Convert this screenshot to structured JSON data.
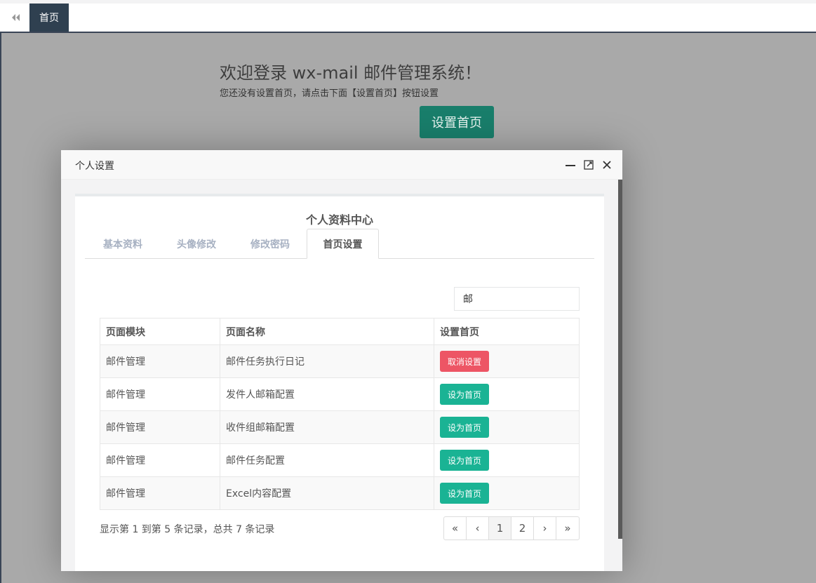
{
  "topbar": {
    "home_tab": "首页"
  },
  "welcome": {
    "title": "欢迎登录 wx-mail 邮件管理系统！",
    "subtitle": "您还没有设置首页，请点击下面【设置首页】按钮设置",
    "set_home_button": "设置首页"
  },
  "modal": {
    "title": "个人设置",
    "panel_title": "个人资料中心",
    "tabs": [
      {
        "label": "基本资料"
      },
      {
        "label": "头像修改"
      },
      {
        "label": "修改密码"
      },
      {
        "label": "首页设置"
      }
    ],
    "active_tab": "首页设置",
    "search": {
      "value": "邮",
      "placeholder": ""
    },
    "table": {
      "headers": [
        "页面模块",
        "页面名称",
        "设置首页"
      ],
      "rows": [
        {
          "module": "邮件管理",
          "name": "邮件任务执行日记",
          "action": "取消设置"
        },
        {
          "module": "邮件管理",
          "name": "发件人邮箱配置",
          "action": "设为首页"
        },
        {
          "module": "邮件管理",
          "name": "收件组邮箱配置",
          "action": "设为首页"
        },
        {
          "module": "邮件管理",
          "name": "邮件任务配置",
          "action": "设为首页"
        },
        {
          "module": "邮件管理",
          "name": "Excel内容配置",
          "action": "设为首页"
        }
      ]
    },
    "page_info": "显示第 1 到第 5 条记录，总共 7 条记录",
    "pager": {
      "first": "«",
      "prev": "‹",
      "pages": [
        "1",
        "2"
      ],
      "current": "1",
      "next": "›",
      "last": "»"
    }
  },
  "colors": {
    "nav_dark": "#2f4050",
    "primary": "#1ab394",
    "danger": "#ed5565",
    "overlay": "#a9a9a9"
  },
  "icons": [
    "double-left-arrow-icon",
    "minimize-icon",
    "maximize-icon",
    "close-icon"
  ]
}
